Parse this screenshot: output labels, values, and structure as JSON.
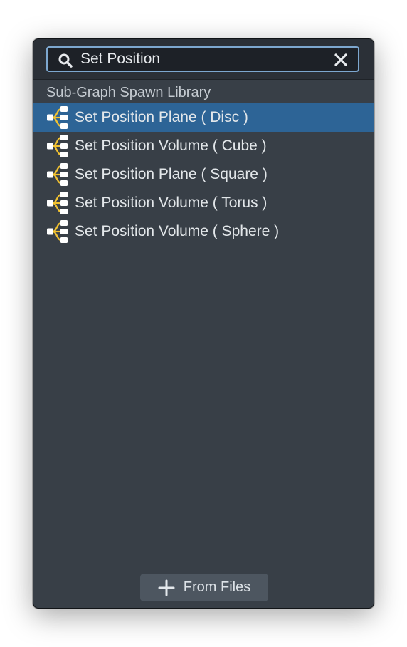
{
  "search": {
    "value": "Set Position",
    "icon": "search-icon",
    "clear_icon": "close-icon"
  },
  "library": {
    "header": "Sub-Graph Spawn Library",
    "item_icon": "subgraph-icon",
    "item_icon_color": "#f2c230",
    "selected_color": "#2d6496",
    "items": [
      {
        "label": "Set Position Plane ( Disc )"
      },
      {
        "label": "Set Position Volume ( Cube )"
      },
      {
        "label": "Set Position Plane ( Square )"
      },
      {
        "label": "Set Position Volume ( Torus )"
      },
      {
        "label": "Set Position Volume ( Sphere )"
      }
    ]
  },
  "footer": {
    "button_label": "From Files",
    "button_icon": "plus-icon"
  }
}
